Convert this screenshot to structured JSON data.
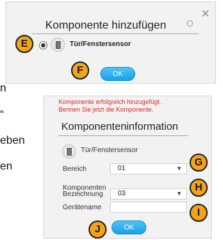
{
  "background_text": {
    "line1": "n",
    "line2": "“",
    "line3": "eben",
    "line4": "en"
  },
  "dialog1": {
    "title": "Komponente hinzufügen",
    "close_symbol": "×",
    "sensor_name": "Tür/Fenstersensor",
    "ok_label": "OK"
  },
  "dialog2": {
    "success_line1": "Komponente erfolgreich hinzugefügt.",
    "success_line2": "Bennen Sie jetzt die Komponente.",
    "title": "Komponenteninformation",
    "sensor_name": "Tür/Fenstersensor",
    "bereich_label": "Bereich",
    "bereich_value": "01",
    "bezeichnung_label_line1": "Komponenten",
    "bezeichnung_label_line2": "Bezeichnung",
    "bezeichnung_value": "03",
    "geraetename_label": "Gerätename",
    "geraetename_value": "",
    "ok_label": "OK"
  },
  "markers": {
    "E": "E",
    "F": "F",
    "G": "G",
    "H": "H",
    "I": "I",
    "J": "J"
  },
  "colors": {
    "marker": "#f5a31a",
    "button": "#19a2e6",
    "success_text": "#d9262e"
  },
  "icons": {
    "close": "close-icon",
    "spinner": "spinner-icon",
    "sensor": "door-sensor-icon",
    "dropdown": "chevron-down-icon"
  }
}
